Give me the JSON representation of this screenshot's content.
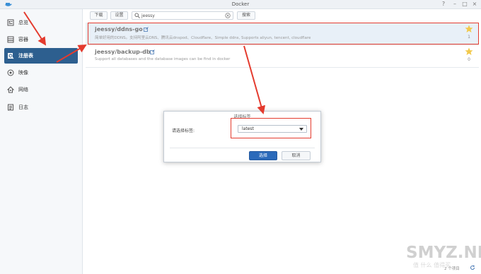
{
  "window": {
    "title": "Docker"
  },
  "sidebar": {
    "items": [
      {
        "label": "总览",
        "icon": "overview-icon",
        "active": false
      },
      {
        "label": "容器",
        "icon": "container-icon",
        "active": false
      },
      {
        "label": "注册表",
        "icon": "registry-icon",
        "active": true
      },
      {
        "label": "映像",
        "icon": "image-icon",
        "active": false
      },
      {
        "label": "网络",
        "icon": "network-icon",
        "active": false
      },
      {
        "label": "日志",
        "icon": "log-icon",
        "active": false
      }
    ]
  },
  "toolbar": {
    "download_label": "下载",
    "settings_label": "设置",
    "search_value": "jeessy",
    "search_button_label": "搜索"
  },
  "results": [
    {
      "name": "jeessy/ddns-go",
      "description": "简单好用的DDNS。支持阿里云DNS、腾讯云dnspod、Cloudflare、Simple ddns, Supports aliyun, tencent, cloudflare",
      "stars": "1",
      "selected": true
    },
    {
      "name": "jeessy/backup-db",
      "description": "Support all databases and the database images can be find in docker",
      "stars": "0",
      "selected": false
    }
  ],
  "dialog": {
    "title": "选择标签",
    "label": "请选择标签:",
    "selected_tag": "latest",
    "ok_label": "选择",
    "cancel_label": "取消"
  },
  "footer": {
    "count_text": "2 个项目"
  },
  "watermark": {
    "text": "SMYZ.NET",
    "sub": "值 什么 值得买"
  },
  "colors": {
    "accent": "#2d5f8f",
    "button_primary": "#2b6aba",
    "annotation": "#e43b2e",
    "star": "#f2c94c"
  }
}
